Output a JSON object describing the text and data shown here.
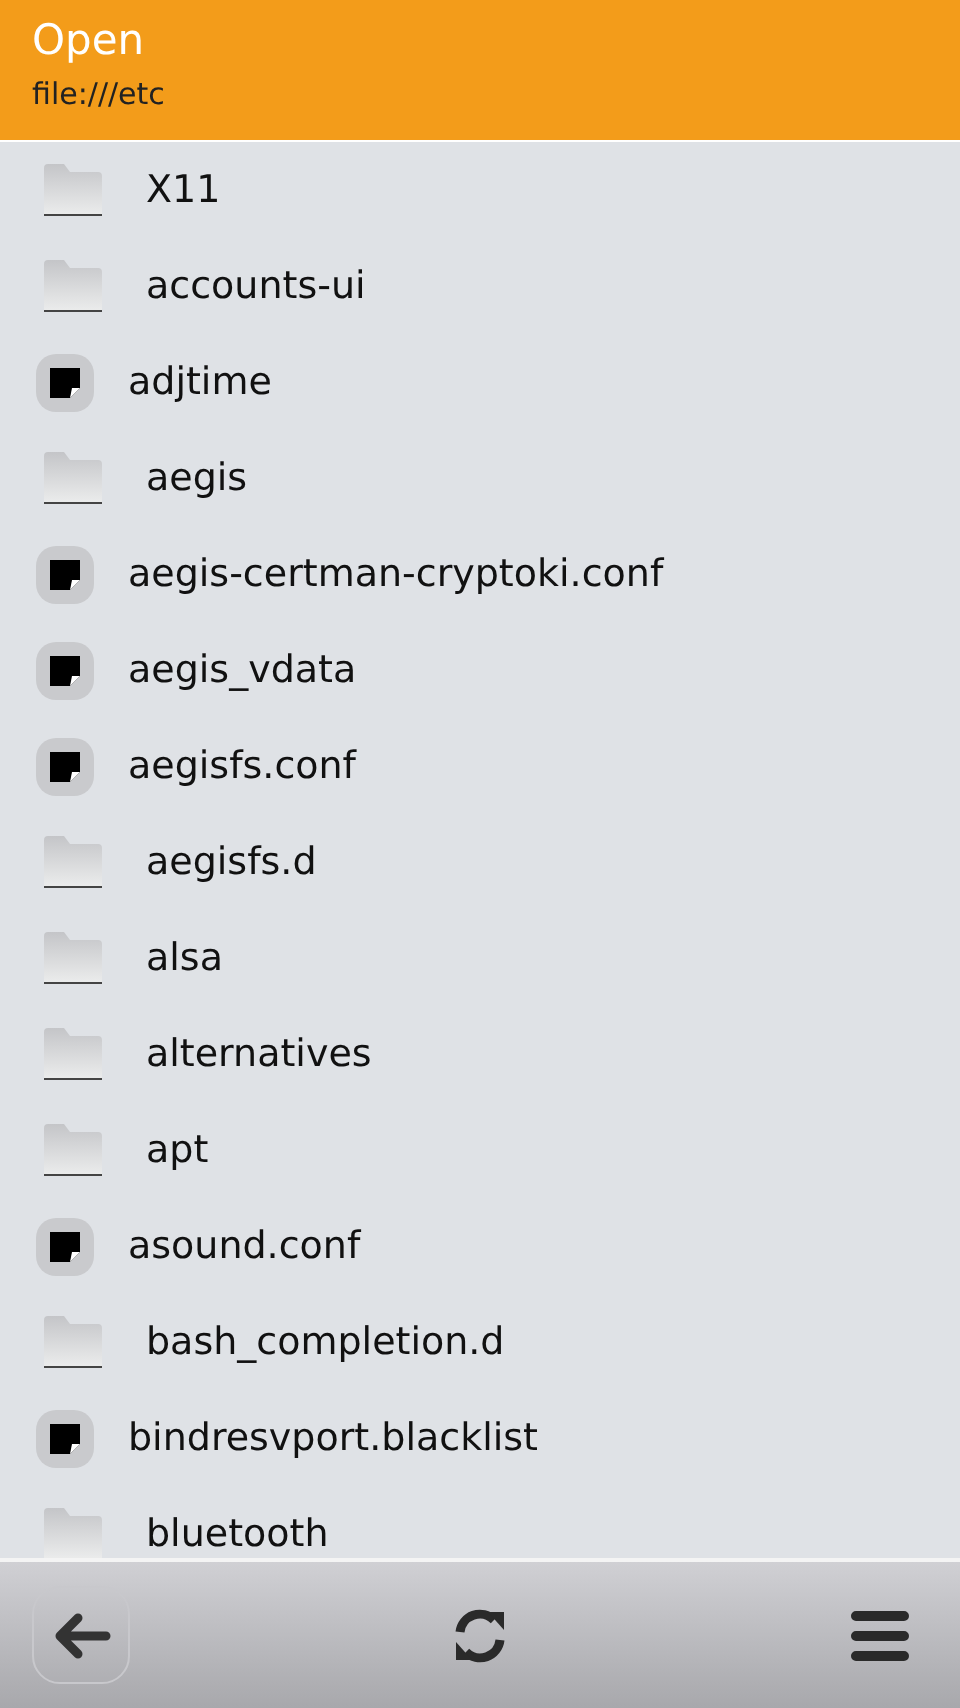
{
  "header": {
    "title": "Open",
    "path": "file:///etc"
  },
  "files": [
    {
      "kind": "folder",
      "name": "X11"
    },
    {
      "kind": "folder",
      "name": "accounts-ui"
    },
    {
      "kind": "file",
      "name": "adjtime"
    },
    {
      "kind": "folder",
      "name": "aegis"
    },
    {
      "kind": "file",
      "name": "aegis-certman-cryptoki.conf"
    },
    {
      "kind": "file",
      "name": "aegis_vdata"
    },
    {
      "kind": "file",
      "name": "aegisfs.conf"
    },
    {
      "kind": "folder",
      "name": "aegisfs.d"
    },
    {
      "kind": "folder",
      "name": "alsa"
    },
    {
      "kind": "folder",
      "name": "alternatives"
    },
    {
      "kind": "folder",
      "name": "apt"
    },
    {
      "kind": "file",
      "name": "asound.conf"
    },
    {
      "kind": "folder",
      "name": "bash_completion.d"
    },
    {
      "kind": "file",
      "name": "bindresvport.blacklist"
    },
    {
      "kind": "folder",
      "name": "bluetooth"
    }
  ]
}
